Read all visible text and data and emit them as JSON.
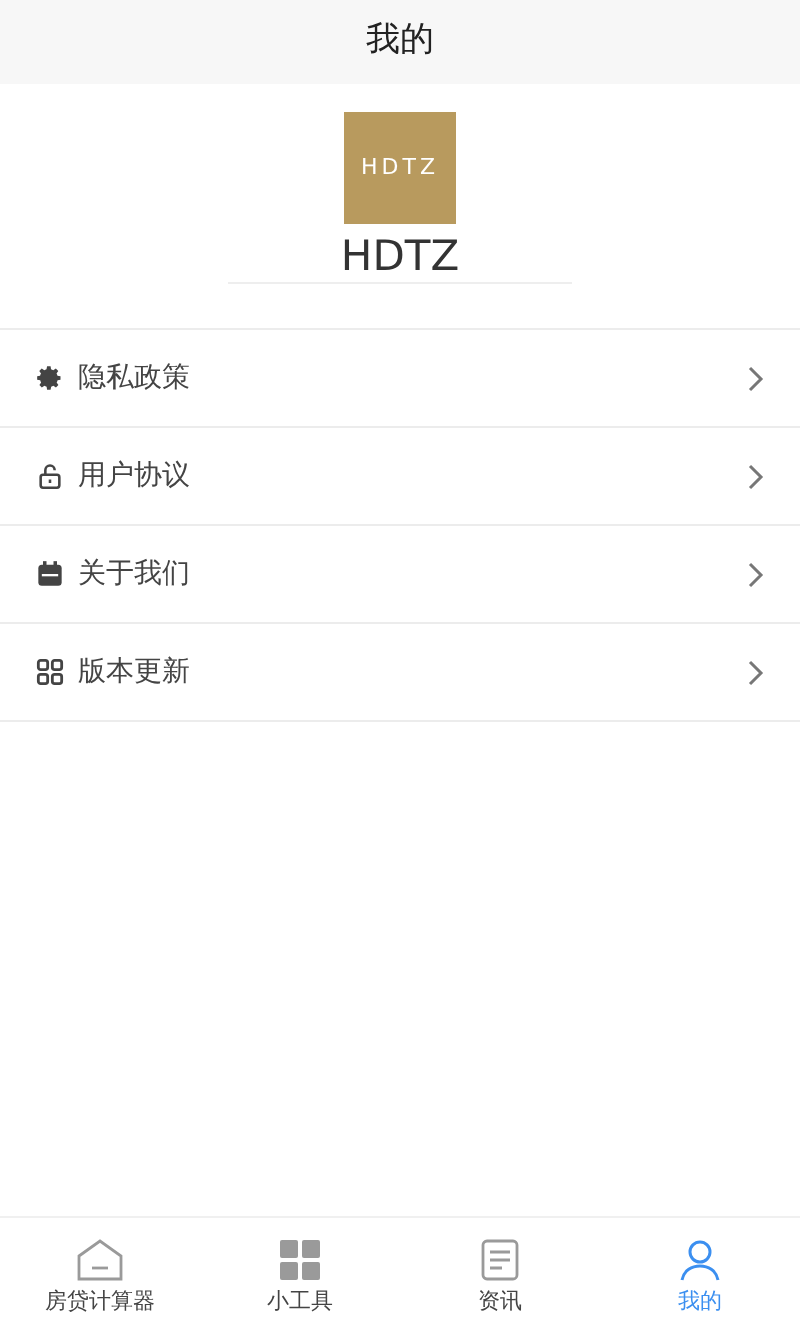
{
  "header": {
    "title": "我的"
  },
  "profile": {
    "logo_text": "HDTZ",
    "name": "HDTZ"
  },
  "menu": [
    {
      "label": "隐私政策",
      "kind": "gear"
    },
    {
      "label": "用户协议",
      "kind": "lock"
    },
    {
      "label": "关于我们",
      "kind": "calendar"
    },
    {
      "label": "版本更新",
      "kind": "grid"
    }
  ],
  "tab_bar": [
    {
      "label": "房贷计算器",
      "kind": "home",
      "selected": false
    },
    {
      "label": "小工具",
      "kind": "tools",
      "selected": false
    },
    {
      "label": "资讯",
      "kind": "news",
      "selected": false
    },
    {
      "label": "我的",
      "kind": "user",
      "selected": true
    }
  ]
}
